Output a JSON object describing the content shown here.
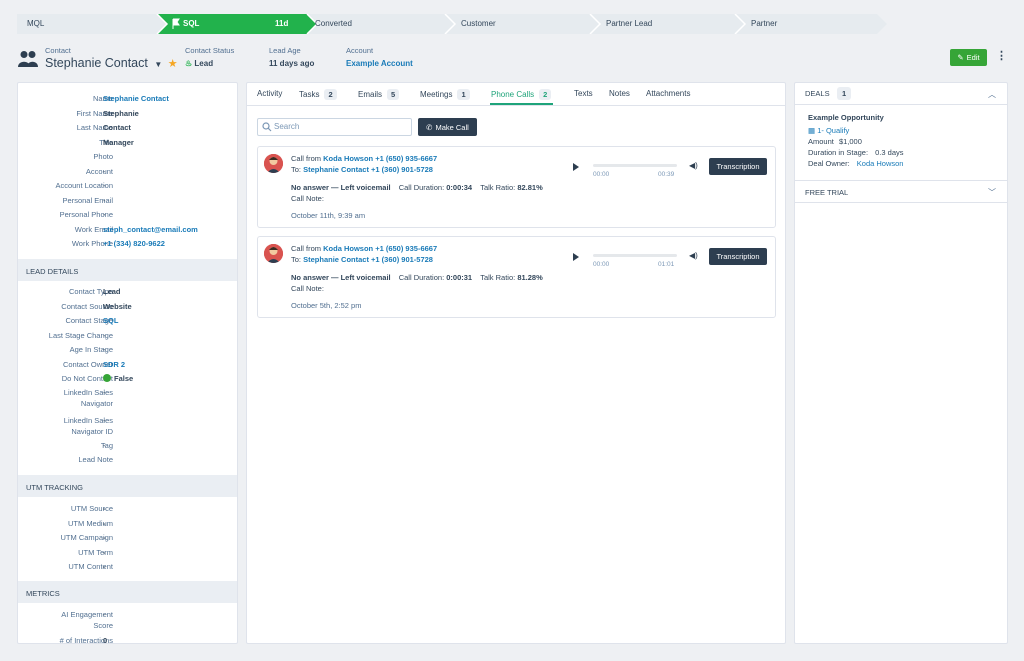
{
  "stages": [
    {
      "label": "MQL"
    },
    {
      "label": "SQL",
      "days": "11d",
      "active": true
    },
    {
      "label": "Converted"
    },
    {
      "label": "Customer"
    },
    {
      "label": "Partner Lead"
    },
    {
      "label": "Partner"
    }
  ],
  "header": {
    "contact_label": "Contact",
    "contact_name": "Stephanie Contact",
    "status_label": "Contact Status",
    "status_value": "Lead",
    "age_label": "Lead Age",
    "age_value": "11 days ago",
    "account_label": "Account",
    "account_value": "Example Account",
    "edit_label": "Edit"
  },
  "fields": [
    {
      "k": "Name",
      "v": "Stephanie Contact",
      "type": "link"
    },
    {
      "k": "First Name",
      "v": "Stephanie"
    },
    {
      "k": "Last Name",
      "v": "Contact"
    },
    {
      "k": "Title",
      "v": "Manager"
    },
    {
      "k": "Photo",
      "v": ""
    },
    {
      "k": "Account",
      "v": "-",
      "type": "plain"
    },
    {
      "k": "Account Location",
      "v": "-",
      "type": "plain"
    },
    {
      "k": "Personal Email",
      "v": "-",
      "type": "plain"
    },
    {
      "k": "Personal Phone",
      "v": "-",
      "type": "plain"
    },
    {
      "k": "Work Email",
      "v": "steph_contact@email.com",
      "type": "link"
    },
    {
      "k": "Work Phone",
      "v": "+1 (334) 820-9622",
      "type": "link"
    }
  ],
  "lead_details": {
    "title": "LEAD DETAILS",
    "fields": [
      {
        "k": "Contact Type",
        "v": "Lead"
      },
      {
        "k": "Contact Source",
        "v": "Website"
      },
      {
        "k": "Contact Stage",
        "v": "SQL",
        "type": "link"
      },
      {
        "k": "Last Stage Change",
        "v": "-",
        "type": "plain"
      },
      {
        "k": "Age In Stage",
        "v": "-",
        "type": "plain"
      },
      {
        "k": "Contact Owner",
        "v": "SDR 2",
        "type": "link"
      },
      {
        "k": "Do Not Contact",
        "v": "False",
        "type": "dot"
      },
      {
        "k": "LinkedIn Sales",
        "k2": "Navigator",
        "v": "-",
        "type": "plain"
      },
      {
        "k": "LinkedIn Sales",
        "k2": "Navigator ID",
        "v": "-",
        "type": "plain"
      },
      {
        "k": "Tag",
        "v": "-",
        "type": "plain"
      },
      {
        "k": "Lead Note",
        "v": ""
      }
    ]
  },
  "utm": {
    "title": "UTM TRACKING",
    "fields": [
      {
        "k": "UTM Source",
        "v": "-"
      },
      {
        "k": "UTM Medium",
        "v": "-"
      },
      {
        "k": "UTM Campaign",
        "v": "-"
      },
      {
        "k": "UTM Term",
        "v": "-"
      },
      {
        "k": "UTM Content",
        "v": "-"
      }
    ]
  },
  "metrics": {
    "title": "METRICS",
    "fields": [
      {
        "k": "AI Engagement",
        "k2": "Score",
        "v": "-",
        "type": "plain"
      },
      {
        "k": "# of Interactions",
        "v": "0"
      }
    ]
  },
  "tabs": [
    {
      "label": "Activity"
    },
    {
      "label": "Tasks",
      "count": "2"
    },
    {
      "label": "Emails",
      "count": "5"
    },
    {
      "label": "Meetings",
      "count": "1"
    },
    {
      "label": "Phone Calls",
      "count": "2",
      "active": true
    },
    {
      "label": "Texts"
    },
    {
      "label": "Notes"
    },
    {
      "label": "Attachments"
    }
  ],
  "search_placeholder": "Search",
  "make_call_label": "Make Call",
  "calls": [
    {
      "from_prefix": "Call from",
      "from_name": "Koda Howson",
      "from_phone": "+1 (650) 935-6667",
      "to_prefix": "To:",
      "to_name": "Stephanie Contact",
      "to_phone": "+1 (360) 901-5728",
      "outcome": "No answer — Left voicemail",
      "duration_label": "Call Duration:",
      "duration": "0:00:34",
      "ratio_label": "Talk Ratio:",
      "ratio": "82.81%",
      "note_label": "Call Note:",
      "date": "October 11th, 9:39 am",
      "time_start": "00:00",
      "time_end": "00:39",
      "progress": 0,
      "transcription_label": "Transcription"
    },
    {
      "from_prefix": "Call from",
      "from_name": "Koda Howson",
      "from_phone": "+1 (650) 935-6667",
      "to_prefix": "To:",
      "to_name": "Stephanie Contact",
      "to_phone": "+1 (360) 901-5728",
      "outcome": "No answer — Left voicemail",
      "duration_label": "Call Duration:",
      "duration": "0:00:31",
      "ratio_label": "Talk Ratio:",
      "ratio": "81.28%",
      "note_label": "Call Note:",
      "date": "October 5th, 2:52 pm",
      "time_start": "00:00",
      "time_end": "01:01",
      "progress": 0,
      "transcription_label": "Transcription"
    }
  ],
  "deals": {
    "title": "DEALS",
    "count": "1",
    "name": "Example Opportunity",
    "stage": "1- Qualify",
    "amount_label": "Amount",
    "amount": "$1,000",
    "duration_label": "Duration in Stage:",
    "duration": "0.3 days",
    "owner_label": "Deal Owner:",
    "owner": "Koda Howson"
  },
  "free_trial_title": "FREE TRIAL",
  "colors": {
    "accent": "#1fa47a",
    "stage_active": "#22b24c",
    "link": "#1a7bb8",
    "dark_button": "#2d3e50",
    "edit_button": "#36a537"
  }
}
